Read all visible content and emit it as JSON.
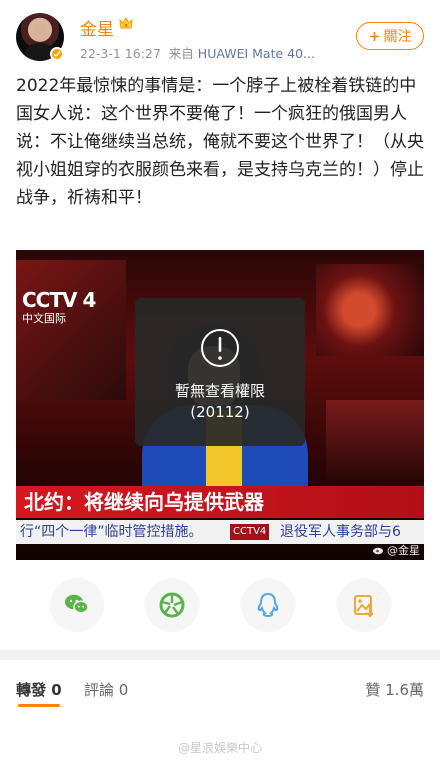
{
  "user": {
    "name": "金星",
    "timestamp": "22-3-1 16:27",
    "source_prefix": "来自",
    "device": "HUAWEI Mate 40...",
    "follow_label": "關注"
  },
  "post": {
    "text": "2022年最惊悚的事情是：一个脖子上被栓着铁链的中国女人说：这个世界不要俺了！一个疯狂的俄国男人说：不让俺继续当总统，俺就不要这个世界了！（从央视小姐姐穿的衣服颜色来看，是支持乌克兰的！）停止战争，祈祷和平！"
  },
  "media": {
    "channel_logo": "CCTV 4",
    "channel_sub": "中文国际",
    "headline": "北约：将继续向乌提供武器",
    "ticker_left": "行“四个一律”临时管控措施。",
    "ticker_badge": "CCTV4",
    "ticker_right": "退役军人事务部与6",
    "watermark": "@金星",
    "overlay_message": "暫無查看權限",
    "overlay_code": "(20112)"
  },
  "share_icons": [
    "wechat-icon",
    "moments-icon",
    "qq-icon",
    "save-image-icon"
  ],
  "tabs": {
    "repost_label": "轉發",
    "repost_count": "0",
    "comment_label": "評論",
    "comment_count": "0",
    "like_label": "贊",
    "like_count": "1.6萬"
  },
  "footer": {
    "watermark": "@星浪娛樂中心"
  },
  "colors": {
    "accent": "#ff8200",
    "meta": "#939393",
    "device": "#5f78a8",
    "headline_red": "#d7171f"
  }
}
